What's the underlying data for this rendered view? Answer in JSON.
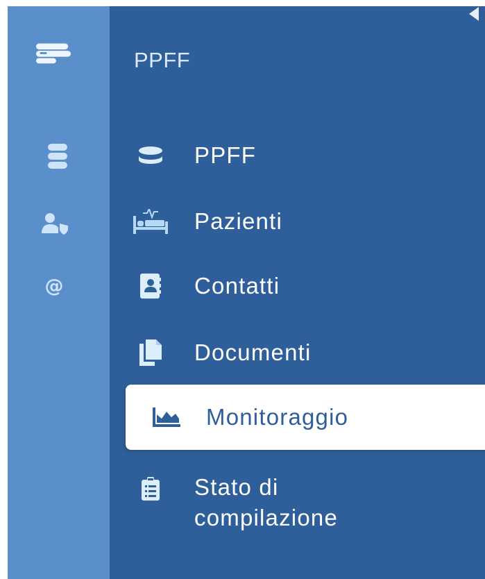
{
  "app": {
    "module_title": "PPFF"
  },
  "rail": {
    "items": [
      {
        "icon": "logo-icon"
      },
      {
        "icon": "database-icon"
      },
      {
        "icon": "user-shield-icon"
      },
      {
        "icon": "at-icon",
        "glyph": "@"
      }
    ]
  },
  "menu": {
    "items": [
      {
        "label": "PPFF",
        "icon": "database-icon"
      },
      {
        "label": "Pazienti",
        "icon": "bed-icon"
      },
      {
        "label": "Contatti",
        "icon": "address-book-icon"
      },
      {
        "label": "Documenti",
        "icon": "copy-icon"
      },
      {
        "label": "Monitoraggio",
        "icon": "area-chart-icon",
        "active": true
      },
      {
        "label": "Stato di compilazione",
        "icon": "clipboard-list-icon"
      }
    ]
  },
  "colors": {
    "rail_bg": "#5b8fcb",
    "panel_bg": "#2f5f9a",
    "active_bg": "#ffffff",
    "icon_color": "#b8d9f6"
  }
}
